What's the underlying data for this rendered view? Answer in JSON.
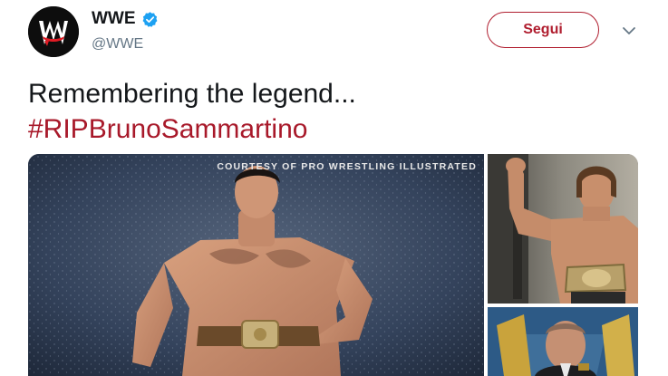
{
  "account": {
    "display_name": "WWE",
    "handle": "@WWE",
    "verified": true,
    "avatar_icon": "wwe-logo-icon"
  },
  "follow_button": {
    "label": "Segui"
  },
  "more_menu": {
    "icon": "chevron-down-icon"
  },
  "tweet": {
    "text_line": "Remembering the legend...",
    "hashtag": "#RIPBrunoSammartino"
  },
  "media": {
    "main_photo": {
      "caption": "COURTESY OF PRO WRESTLING ILLUSTRATED"
    }
  },
  "colors": {
    "accent": "#b01e2f",
    "hashtag": "#a8192a",
    "verified": "#1da1f2",
    "handle_gray": "#657786",
    "text": "#14171a"
  }
}
